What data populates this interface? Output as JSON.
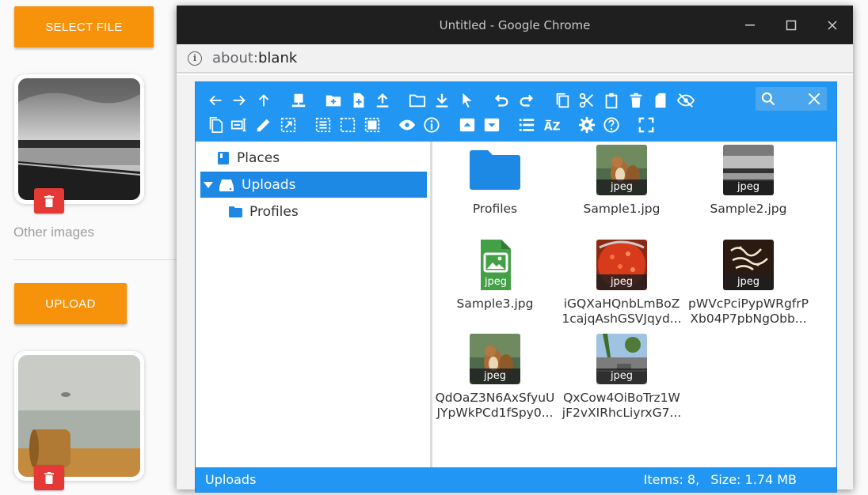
{
  "page": {
    "select_file_label": "SELECT FILE",
    "other_images_label": "Other images",
    "upload_label": "UPLOAD"
  },
  "browser": {
    "window_title": "Untitled - Google Chrome",
    "url_scheme": "about:",
    "url_rest": "blank"
  },
  "file_manager": {
    "toolbar_row1": [
      "back-icon",
      "forward-icon",
      "up-icon",
      "computer-icon",
      "new-folder-icon",
      "new-file-icon",
      "upload-icon",
      "open-folder-icon",
      "download-icon",
      "select-icon",
      "undo-icon",
      "redo-icon",
      "copy-icon",
      "cut-icon",
      "paste-icon",
      "delete-icon",
      "empty-icon",
      "hide-icon"
    ],
    "toolbar_row2": [
      "duplicate-icon",
      "rename-icon",
      "edit-icon",
      "resize-icon",
      "select-all-icon",
      "select-none-icon",
      "invert-selection-icon",
      "view-icon",
      "info-icon",
      "extract-icon",
      "archive-icon",
      "list-view-icon",
      "sort-icon",
      "settings-icon",
      "help-icon",
      "fullscreen-icon"
    ],
    "tree": {
      "places": "Places",
      "uploads": "Uploads",
      "profiles": "Profiles"
    },
    "files": [
      {
        "name_line1": "Profiles",
        "name_line2": "",
        "type": "folder",
        "badge": ""
      },
      {
        "name_line1": "Sample1.jpg",
        "name_line2": "",
        "type": "squirrel",
        "badge": "jpeg"
      },
      {
        "name_line1": "Sample2.jpg",
        "name_line2": "",
        "type": "lake",
        "badge": "jpeg"
      },
      {
        "name_line1": "Sample3.jpg",
        "name_line2": "",
        "type": "image-file",
        "badge": "jpeg"
      },
      {
        "name_line1": "iGQXaHQnbLmBoZ",
        "name_line2": "1cajqAshGSVJqyd...",
        "type": "food",
        "badge": "jpeg"
      },
      {
        "name_line1": "pWVcPciPypWRgfrP",
        "name_line2": "Xb04P7pbNgObb...",
        "type": "calligraphy",
        "badge": "jpeg"
      },
      {
        "name_line1": "QdOaZ3N6AxSfyuU",
        "name_line2": "JYpWkPCd1fSpy0...",
        "type": "squirrel",
        "badge": "jpeg"
      },
      {
        "name_line1": "QxCow4OiBoTrz1W",
        "name_line2": "jF2vXIRhcLiyrxG7...",
        "type": "street",
        "badge": "jpeg"
      }
    ],
    "status": {
      "location": "Uploads",
      "items": "Items: 8,",
      "size": "Size: 1.74 MB"
    }
  },
  "colors": {
    "accent_blue": "#2196f3",
    "orange": "#f7930a",
    "delete_red": "#e53935"
  }
}
